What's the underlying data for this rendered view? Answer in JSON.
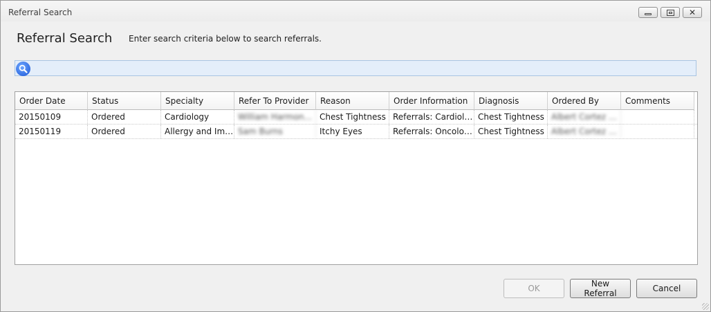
{
  "window": {
    "title": "Referral Search",
    "controls": {
      "minimize": "minimize-icon",
      "maximize": "maximize-icon",
      "close": "close-icon"
    }
  },
  "header": {
    "title": "Referral Search",
    "instructions": "Enter search criteria below to search referrals."
  },
  "search": {
    "value": "",
    "placeholder": "",
    "icon": "search-icon",
    "accent": "#2a6be8"
  },
  "table": {
    "columns": [
      "Order Date",
      "Status",
      "Specialty",
      "Refer To Provider",
      "Reason",
      "Order Information",
      "Diagnosis",
      "Ordered By",
      "Comments"
    ],
    "rows": [
      [
        "20150109",
        "Ordered",
        "Cardiology",
        "William Harmon...",
        "Chest Tightness",
        "Referrals:  Cardiology",
        "Chest Tightness",
        "Albert Cortez M...",
        ""
      ],
      [
        "20150119",
        "Ordered",
        "Allergy and Immun...",
        "Sam Burns",
        "Itchy Eyes",
        "Referrals:  Oncology...",
        "Chest Tightness",
        "Albert Cortez M...",
        ""
      ]
    ]
  },
  "buttons": {
    "ok": "OK",
    "new_referral": "New Referral",
    "cancel": "Cancel"
  }
}
